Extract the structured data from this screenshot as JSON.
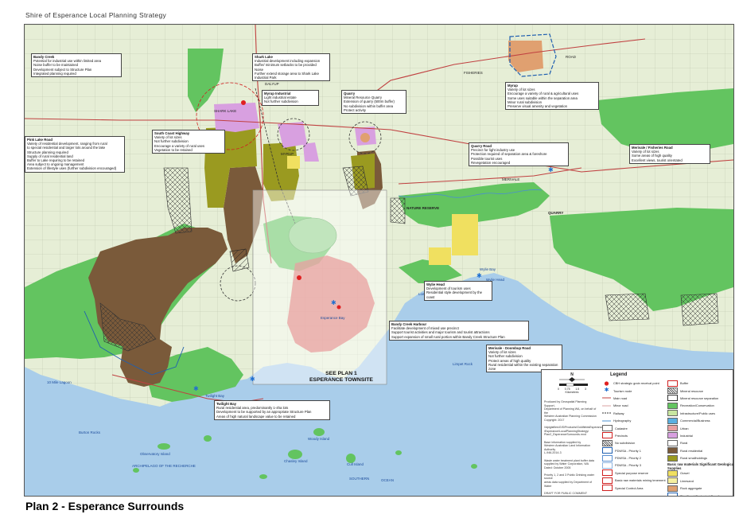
{
  "header": {
    "title": "Shire of Esperance Local Planning Strategy"
  },
  "footer": {
    "title": "Plan 2 - Esperance Surrounds"
  },
  "see_plan": {
    "line1": "SEE PLAN 1",
    "line2": "ESPERANCE TOWNSITE"
  },
  "map_labels": {
    "archipelago": "ARCHIPELAGO    OF    THE    RECHERCHE",
    "southern_ocean": "SOUTHERN",
    "ocean": "OCEAN",
    "nature_reserve": "NATURE RESERVE",
    "quarry": "QUARRY",
    "wylie_head": "Wylie Head",
    "wylie_bay": "Wylie Bay",
    "low_rock": "Low Rock",
    "limpet_rock": "Limpet Rock",
    "button_island": "Button Island",
    "observatory_island": "Observatory Island",
    "chasley_island": "Chasley Island",
    "cull_island": "Cull Island",
    "woody_island": "Woody Island",
    "burton_rocks": "Burton Rocks",
    "twilight_bay": "Twilight Bay",
    "ten_mile_lagoon": "10 Mile Lagoon",
    "fisheries_road": "FISHERIES",
    "road": "ROAD",
    "merivale": "MERIVALE",
    "esperance_bay": "Esperance Bay",
    "shark_lake": "SHARK LAKE",
    "myrup": "MYRUP",
    "coomalbidgup": "DALYUP"
  },
  "callouts": [
    {
      "title": "Bandy Creek",
      "lines": [
        "Potential for industrial use within limited area",
        "Noise buffer to be maintained",
        "Development subject to Structure Plan",
        "Integrated planning required"
      ]
    },
    {
      "title": "Shark Lake",
      "lines": [
        "Industrial development including expansion",
        "Buffer/ minimum setbacks to be provided",
        "Noise",
        "Further extend storage area to Shark Lake",
        "Industrial Park"
      ]
    },
    {
      "title": "Myrup Industrial",
      "lines": [
        "Light industrial estate",
        "Not further subdivision"
      ]
    },
    {
      "title": "Quarry",
      "lines": [
        "Mineral Resource Quarry",
        "Extension of quarry (500m buffer)",
        "No subdivision within buffer area",
        "Protect activity"
      ]
    },
    {
      "title": "Myrup",
      "lines": [
        "Variety of lot sizes",
        "Encourage a variety of rural & agricultural uses",
        "Some uses suitable within the separation area",
        "Minor rural subdivision",
        "Preserve visual amenity and vegetation"
      ]
    },
    {
      "title": "Pink Lake Road",
      "lines": [
        "Variety of residential development, ranging from rural",
        "to special residential and larger lots around the lake",
        "Structure planning required",
        "Supply of rural residential land",
        "Buffer to Lake requiring to be retained",
        "Area subject to ongoing management",
        "Extension of lifestyle uses (further subdivision encouraged)"
      ]
    },
    {
      "title": "South Coast Highway",
      "lines": [
        "Variety of lot sizes",
        "Not further subdivision",
        "Encourage a variety of rural uses",
        "Vegetation to be retained"
      ]
    },
    {
      "title": "Quarry Road",
      "lines": [
        "Precinct for light industry use",
        "Protection required of separation area & foreshore",
        "Possible tourist uses",
        "Revegetation encouraged"
      ]
    },
    {
      "title": "Merivale / Fisheries Road",
      "lines": [
        "Variety of lot sizes",
        "Some areas of high quality",
        "Excellent views, tourist orientated"
      ]
    },
    {
      "title": "Wylie Head",
      "lines": [
        "Development of tourism uses",
        "Residential style development by the coast"
      ]
    },
    {
      "title": "Bandy Creek Harbour",
      "lines": [
        "Facilitate development of mixed use precinct",
        "Support tourist activities and major tourism and tourist attractions",
        "Support expansion of small rural portion within Bandy Creek Structure Plan"
      ]
    },
    {
      "title": "Merivale - Doombup Road",
      "lines": [
        "Variety of lot sizes",
        "Not further subdivision",
        "Protect areas of high quality",
        "Rural residential within the existing separation zone"
      ]
    },
    {
      "title": "Twilight Bay",
      "lines": [
        "Rural residential area, predominantly 1-4ha lots",
        "Development to be supported by an appropriate Structure Plan",
        "Areas of high natural landscape value to be retained"
      ]
    }
  ],
  "legend": {
    "title": "Legend",
    "north": "N",
    "scale_label": "Kilometres",
    "scale_ticks": [
      "0",
      "0.75",
      "1.5",
      "3"
    ],
    "production": [
      "Produced by Geospatial Planning Support,",
      "Department of Planning WA, on behalf of the",
      "Western Australian Planning Commission",
      "Copyright: 2017",
      "",
      "\\\\dpigisfiles\\GIS\\Products\\GoldfieldsEsperance",
      "\\Esperance\\LocalPlanningStrategy\\",
      "Plan2_EsperanceSurrounds.mxd",
      "",
      "Base information supplied by",
      "Western Australian Land Information Authority",
      "L-946-2014-3",
      "",
      "Waste water treatment plant buffer data",
      "supplied by Water Corporation, WA",
      "Dated: October 2005",
      "",
      "Priority 1, 2 and 3 Public Drinking water source",
      "areas data supplied by Department of Water",
      "",
      "DRAFT FOR PUBLIC COMMENT"
    ],
    "col1": [
      {
        "label": "CBH strategic grain receival point",
        "kind": "dot",
        "color": "#e02020"
      },
      {
        "label": "Tourism node",
        "kind": "star",
        "color": "#1f6fd0"
      },
      {
        "label": "Main road",
        "kind": "line",
        "color": "#c04040"
      },
      {
        "label": "Minor road",
        "kind": "line",
        "color": "#d9a0a0"
      },
      {
        "label": "Railway",
        "kind": "rail",
        "color": "#333333"
      },
      {
        "label": "Hydrography",
        "kind": "line",
        "color": "#4a8fd0"
      },
      {
        "label": "Cadastre",
        "kind": "box",
        "color": "#ffffff"
      },
      {
        "label": "Precincts",
        "kind": "box",
        "color": "#ffffff",
        "border": "#d02020"
      },
      {
        "label": "No subdivision",
        "kind": "hatch",
        "color": "#ffffff"
      },
      {
        "label": "PDWSA - Priority 1",
        "kind": "box",
        "color": "#ffffff",
        "border": "#1f5fb0"
      },
      {
        "label": "PDWSA - Priority 2",
        "kind": "box",
        "color": "#ffffff",
        "border": "#5a8fd0"
      },
      {
        "label": "PDWSA - Priority 3",
        "kind": "box",
        "color": "#ffffff",
        "border": "#8fb4e0"
      },
      {
        "label": "Special purpose reserve",
        "kind": "box",
        "color": "#ffffff",
        "border": "#d02020"
      },
      {
        "label": "Basic raw materials mining tenement",
        "kind": "box",
        "color": "#ffffff",
        "border": "#d02020"
      },
      {
        "label": "Special Control Area",
        "kind": "box",
        "color": "#ffffff",
        "border": "#d02020"
      }
    ],
    "col2": [
      {
        "label": "Buffer",
        "kind": "box",
        "color": "#ffffff",
        "border": "#d02020"
      },
      {
        "label": "Mineral resource",
        "kind": "hatch",
        "color": "#ffffff"
      },
      {
        "label": "Mineral resource separation",
        "kind": "box",
        "color": "#ffffff",
        "border": "#333333"
      },
      {
        "label": "Recreation/Conservation",
        "kind": "box",
        "color": "#63c460"
      },
      {
        "label": "Infrastructure/Public uses",
        "kind": "box",
        "color": "#c8e6a0"
      },
      {
        "label": "Commercial/Business",
        "kind": "box",
        "color": "#5ab0e0"
      },
      {
        "label": "Urban",
        "kind": "box",
        "color": "#e8a0a0"
      },
      {
        "label": "Industrial",
        "kind": "box",
        "color": "#d8a0e0"
      },
      {
        "label": "Rural",
        "kind": "box",
        "color": "#ffffff"
      },
      {
        "label": "Rural residential",
        "kind": "box",
        "color": "#7a5a3a"
      },
      {
        "label": "Rural smallholdings",
        "kind": "box",
        "color": "#9a9a20"
      }
    ],
    "bm_heading": "Basic raw materials Significant Geological Supplies",
    "col2b": [
      {
        "label": "Gravel",
        "kind": "box",
        "color": "#f0e060"
      },
      {
        "label": "Limesand",
        "kind": "box",
        "color": "#f6f0a0"
      },
      {
        "label": "Rock aggregate",
        "kind": "box",
        "color": "#e0a070"
      },
      {
        "label": "Significant Geological Supplies separation",
        "kind": "box",
        "color": "#ffffff",
        "border": "#1f5fb0"
      }
    ]
  },
  "colors": {
    "ocean": "#a9cdea",
    "land": "#dde8c9",
    "conservation": "#63c460",
    "rural_residential": "#7a5a3a",
    "smallholdings": "#9a9a20",
    "industrial": "#d8a0e0",
    "gravel": "#f0e060",
    "rock": "#e0a070",
    "main_road": "#c04040"
  }
}
